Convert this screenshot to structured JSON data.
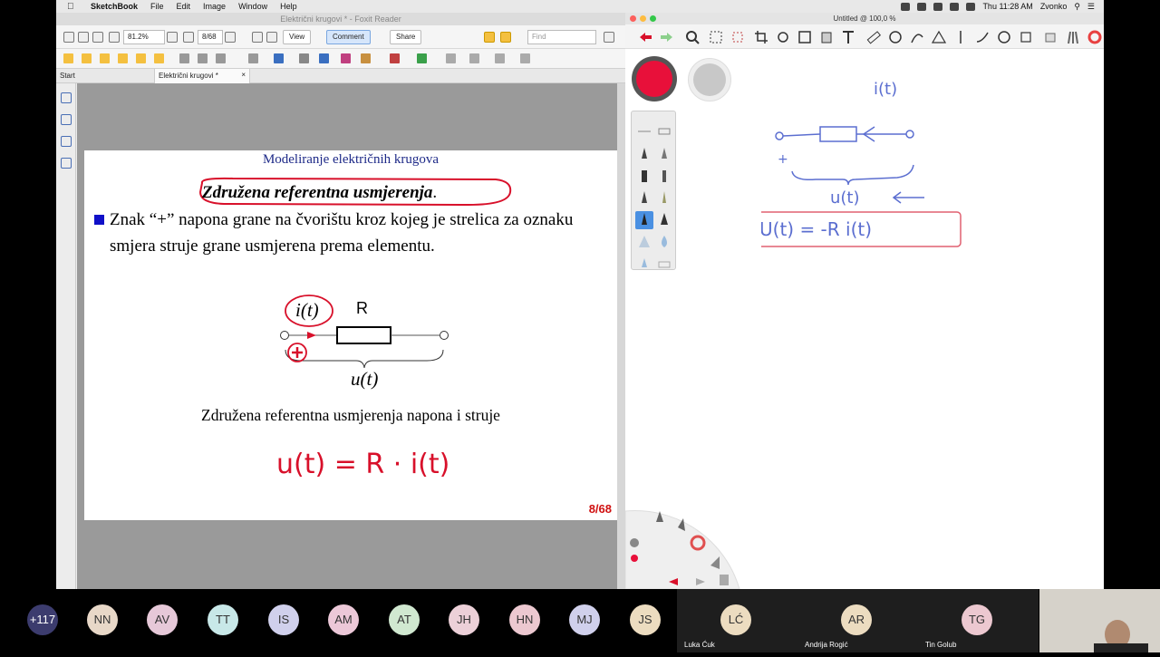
{
  "menubar": {
    "apple": "",
    "app_name": "SketchBook",
    "items": [
      "File",
      "Edit",
      "Image",
      "Window",
      "Help"
    ],
    "clock": "Thu 11:28 AM",
    "user": "Zvonko"
  },
  "foxit": {
    "window_title": "Električni krugovi * - Foxit Reader",
    "zoom": "81.2%",
    "page_indicator": "8/68",
    "view_label": "View",
    "comment_label": "Comment",
    "share_label": "Share",
    "find_placeholder": "Find",
    "tab_start": "Start",
    "tab_doc": "Električni krugovi *",
    "tab_close": "×"
  },
  "slide": {
    "header": "Modeliranje električnih krugova",
    "title": "Združena referentna usmjerenja",
    "title_suffix": ".",
    "bullet_text": "Znak “+” napona grane na čvorištu kroz kojeg je strelica za oznaku smjera struje grane usmjerena prema elementu.",
    "r_label": "R",
    "current_label": "i(t)",
    "voltage_label": "u(t)",
    "caption": "Združena referentna usmjerenja napona i struje",
    "page": "8/68",
    "handwriting": "u(t) = R · i(t)"
  },
  "sketchbook": {
    "window_title": "Untitled @ 100,0 %",
    "primary_color": "#e8103a",
    "secondary_color": "#c8c8c8",
    "handwriting_top": "i(t)",
    "handwriting_mid": "u(t)",
    "handwriting_eq": "U(t) = -R i(t)",
    "handwriting_plus": "+"
  },
  "zoom": {
    "participants": [
      {
        "initials": "+117",
        "color": "#3c3c6e",
        "text_color": "#ffffff"
      },
      {
        "initials": "NN",
        "color": "#e8d8c8"
      },
      {
        "initials": "AV",
        "color": "#e6c8d8"
      },
      {
        "initials": "TT",
        "color": "#c8e8e8"
      },
      {
        "initials": "IS",
        "color": "#d0d0ec"
      },
      {
        "initials": "AM",
        "color": "#ecc8d8"
      },
      {
        "initials": "AT",
        "color": "#d0e8d0"
      },
      {
        "initials": "JH",
        "color": "#ecd0d8"
      },
      {
        "initials": "HN",
        "color": "#ecc8d0"
      },
      {
        "initials": "MJ",
        "color": "#d0d0ec"
      },
      {
        "initials": "JS",
        "color": "#ecdcc0"
      }
    ],
    "named": [
      {
        "initials": "LĆ",
        "name": "Luka Ćuk",
        "color": "#ecdcc0"
      },
      {
        "initials": "AR",
        "name": "Andrija Rogić",
        "color": "#ecdcc0"
      },
      {
        "initials": "TG",
        "name": "Tin Golub",
        "color": "#ecc8d0"
      }
    ]
  }
}
